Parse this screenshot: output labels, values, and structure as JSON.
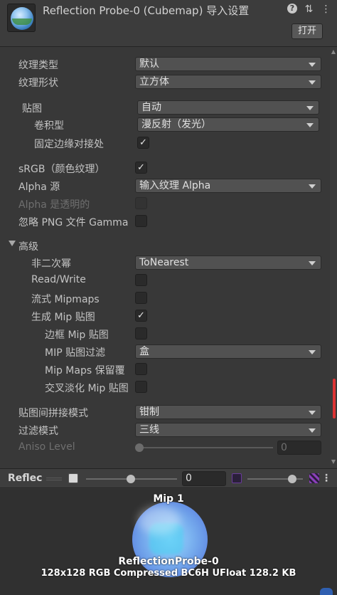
{
  "header": {
    "title": "Reflection Probe-0 (Cubemap) 导入设置",
    "open_button": "打开",
    "icons": [
      "help-icon",
      "preset-icon",
      "more-icon"
    ]
  },
  "fields": {
    "texture_type": {
      "label": "纹理类型",
      "value": "默认"
    },
    "texture_shape": {
      "label": "纹理形状",
      "value": "立方体"
    },
    "mapping": {
      "label": "贴图",
      "value": "自动"
    },
    "convolution": {
      "label": "卷积型",
      "value": "漫反射（发光）"
    },
    "fixup_edge_seams": {
      "label": "固定边缘对接处",
      "checked": true
    },
    "srgb": {
      "label": "sRGB（颜色纹理）",
      "checked": true
    },
    "alpha_source": {
      "label": "Alpha 源",
      "value": "输入纹理 Alpha"
    },
    "alpha_is_transparency": {
      "label": "Alpha 是透明的",
      "checked": false,
      "disabled": true
    },
    "ignore_png_gamma": {
      "label": "忽略 PNG 文件 Gamma",
      "checked": false
    }
  },
  "advanced": {
    "label": "高级",
    "non_power_of_2": {
      "label": "非二次幂",
      "value": "ToNearest"
    },
    "read_write": {
      "label": "Read/Write",
      "checked": false
    },
    "streaming_mipmaps": {
      "label": "流式 Mipmaps",
      "checked": false
    },
    "generate_mipmaps": {
      "label": "生成 Mip 贴图",
      "checked": true
    },
    "border_mipmaps": {
      "label": "边框 Mip 贴图",
      "checked": false
    },
    "mipmap_filtering": {
      "label": "MIP 贴图过滤",
      "value": "盒"
    },
    "preserve_coverage": {
      "label": "Mip Maps 保留覆",
      "checked": false
    },
    "fadeout_mipmaps": {
      "label": "交叉淡化 Mip 贴图",
      "checked": false
    }
  },
  "wrap_mode": {
    "label": "贴图间拼接模式",
    "value": "钳制"
  },
  "filter_mode": {
    "label": "过滤模式",
    "value": "三线"
  },
  "aniso_level": {
    "label": "Aniso Level",
    "value": "0",
    "disabled": true
  },
  "preview": {
    "title": "Reflec",
    "mip_value": "0",
    "mip_label": "Mip 1",
    "name": "ReflectionProbe-0",
    "info": "128x128  RGB Compressed BC6H UFloat   128.2 KB"
  },
  "colors": {
    "background": "#383838",
    "scroll_indicator": "#dd3333",
    "checkbox_bg": "#2a2a2a"
  }
}
